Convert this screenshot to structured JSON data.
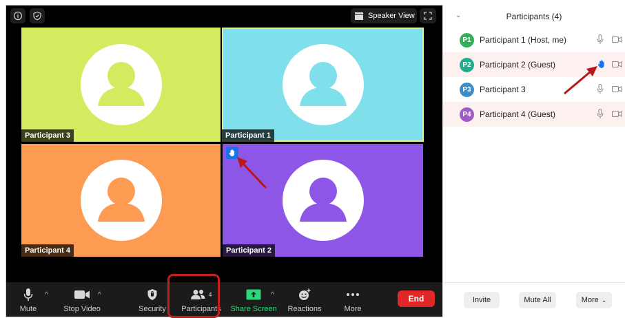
{
  "meeting": {
    "speaker_view_label": "Speaker View",
    "tiles": [
      {
        "name": "Participant 3",
        "bg": "#d3ec5f",
        "fg": "#d3ec5f"
      },
      {
        "name": "Participant 1",
        "bg": "#7fdfea",
        "fg": "#7fdfea"
      },
      {
        "name": "Participant 4",
        "bg": "#fe9b52",
        "fg": "#fe9b52"
      },
      {
        "name": "Participant 2",
        "bg": "#8d56e7",
        "fg": "#8d56e7"
      }
    ]
  },
  "toolbar": {
    "mute_label": "Mute",
    "stop_video_label": "Stop Video",
    "security_label": "Security",
    "participants_label": "Participants",
    "participants_count": "4",
    "share_screen_label": "Share Screen",
    "reactions_label": "Reactions",
    "more_label": "More",
    "end_label": "End"
  },
  "panel": {
    "title": "Participants (4)",
    "participants": [
      {
        "initials": "P1",
        "name": "Participant 1 (Host, me)",
        "color": "#33b05a",
        "hand_raised": false
      },
      {
        "initials": "P2",
        "name": "Participant 2 (Guest)",
        "color": "#1fae8e",
        "hand_raised": true
      },
      {
        "initials": "P3",
        "name": "Participant 3",
        "color": "#3a8ec9",
        "hand_raised": false
      },
      {
        "initials": "P4",
        "name": "Participant 4 (Guest)",
        "color": "#a15ac8",
        "hand_raised": false
      }
    ],
    "invite_label": "Invite",
    "mute_all_label": "Mute All",
    "more_label": "More"
  },
  "colors": {
    "annotation_red": "#c41e1e",
    "end_red": "#e02828",
    "share_green": "#2fd67b",
    "hand_blue": "#1a73e8"
  }
}
